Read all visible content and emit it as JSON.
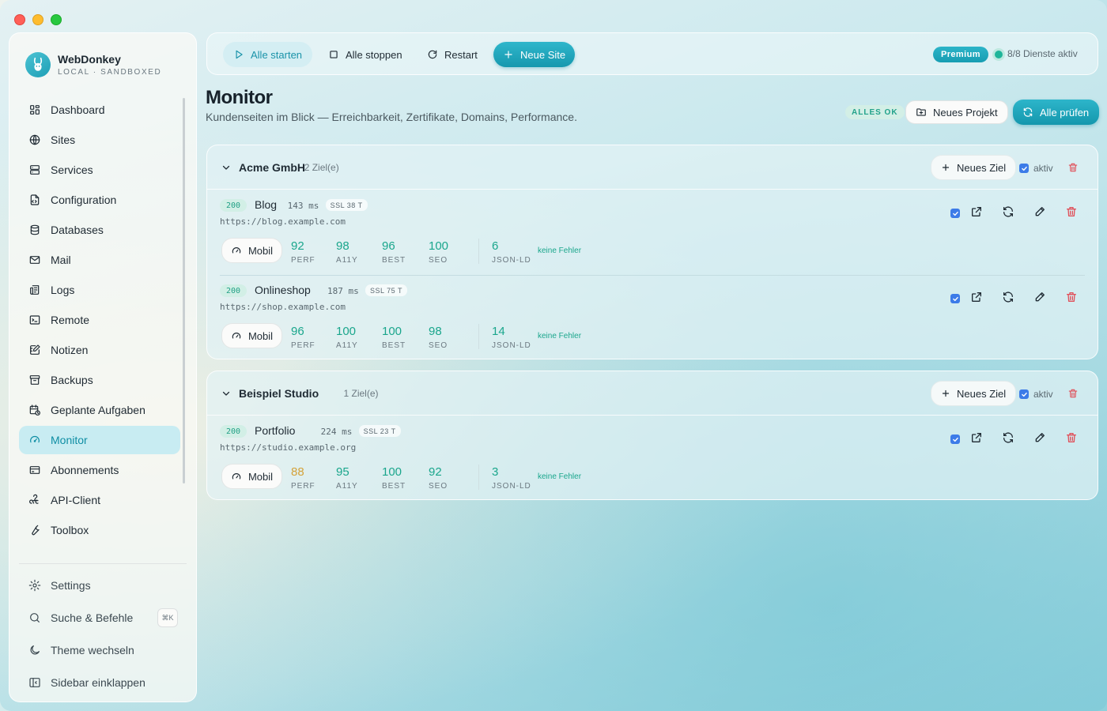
{
  "brand": {
    "name": "WebDonkey",
    "subtitle": "LOCAL · SANDBOXED"
  },
  "nav": [
    {
      "label": "Dashboard",
      "icon": "dashboard-icon"
    },
    {
      "label": "Sites",
      "icon": "globe-icon"
    },
    {
      "label": "Services",
      "icon": "server-icon"
    },
    {
      "label": "Configuration",
      "icon": "config-file-icon"
    },
    {
      "label": "Databases",
      "icon": "database-icon"
    },
    {
      "label": "Mail",
      "icon": "mail-icon"
    },
    {
      "label": "Logs",
      "icon": "logs-icon"
    },
    {
      "label": "Remote",
      "icon": "terminal-icon"
    },
    {
      "label": "Notizen",
      "icon": "notes-icon"
    },
    {
      "label": "Backups",
      "icon": "archive-icon"
    },
    {
      "label": "Geplante Aufgaben",
      "icon": "calendar-clock-icon"
    },
    {
      "label": "Monitor",
      "icon": "gauge-icon",
      "active": true
    },
    {
      "label": "Abonnements",
      "icon": "credit-card-icon"
    },
    {
      "label": "API-Client",
      "icon": "webhook-icon"
    },
    {
      "label": "Toolbox",
      "icon": "wrench-icon"
    }
  ],
  "bottom_nav": {
    "settings": "Settings",
    "search": "Suche & Befehle",
    "search_shortcut": "⌘K",
    "theme": "Theme wechseln",
    "collapse": "Sidebar einklappen"
  },
  "toolbar": {
    "start_all": "Alle starten",
    "stop_all": "Alle stoppen",
    "restart": "Restart",
    "new_site": "Neue Site",
    "premium": "Premium",
    "services_status": "8/8 Dienste aktiv"
  },
  "page": {
    "title": "Monitor",
    "subtitle": "Kundenseiten im Blick — Erreichbarkeit, Zertifikate, Domains, Performance.",
    "status_badge": "ALLES OK",
    "new_project": "Neues Projekt",
    "check_all": "Alle prüfen"
  },
  "colors": {
    "accent": "#1ba3b9",
    "success": "#1aa68c",
    "warn": "#d4a23a",
    "danger": "#e0505a"
  },
  "labels": {
    "new_target": "Neues Ziel",
    "active": "aktiv",
    "mobile": "Mobil",
    "perf": "PERF",
    "a11y": "A11Y",
    "best": "BEST",
    "seo": "SEO",
    "jsonld": "JSON-LD",
    "no_errors": "keine Fehler",
    "ms": "ms"
  },
  "groups": [
    {
      "name": "Acme GmbH",
      "count": "2 Ziel(e)",
      "targets": [
        {
          "code": "200",
          "name": "Blog",
          "ms": "143",
          "ssl": "SSL 38 T",
          "url": "https://blog.example.com",
          "perf": "92",
          "a11y": "98",
          "best": "96",
          "seo": "100",
          "jsonld": "6"
        },
        {
          "code": "200",
          "name": "Onlineshop",
          "ms": "187",
          "ssl": "SSL 75 T",
          "url": "https://shop.example.com",
          "perf": "96",
          "a11y": "100",
          "best": "100",
          "seo": "98",
          "jsonld": "14"
        }
      ]
    },
    {
      "name": "Beispiel Studio",
      "count": "1 Ziel(e)",
      "targets": [
        {
          "code": "200",
          "name": "Portfolio",
          "ms": "224",
          "ssl": "SSL 23 T",
          "url": "https://studio.example.org",
          "perf": "88",
          "a11y": "95",
          "best": "100",
          "seo": "92",
          "jsonld": "3",
          "perf_warn": true
        }
      ]
    }
  ]
}
